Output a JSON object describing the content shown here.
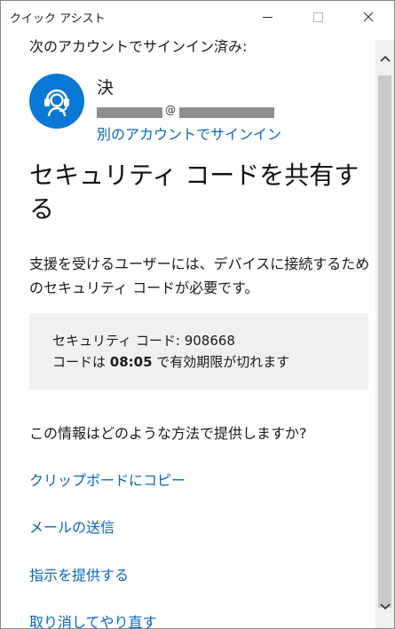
{
  "window": {
    "title": "クイック アシスト"
  },
  "account": {
    "signed_in_label": "次のアカウントでサインイン済み:",
    "name": "決",
    "email_at": "@",
    "switch_label": "別のアカウントでサインイン"
  },
  "heading": "セキュリティ コードを共有する",
  "description": "支援を受けるユーザーには、デバイスに接続するためのセキュリティ コードが必要です。",
  "code_box": {
    "code_prefix": "セキュリティ コード: ",
    "code": "908668",
    "expiry_prefix": "コードは ",
    "expiry_time": "08:05",
    "expiry_suffix": " で有効期限が切れます"
  },
  "share": {
    "question": "この情報はどのような方法で提供しますか?",
    "options": [
      "クリップボードにコピー",
      "メールの送信",
      "指示を提供する",
      "取り消してやり直す"
    ]
  },
  "colors": {
    "accent": "#0a78d6",
    "link": "#0a66c2",
    "code_box_bg": "#f0f0f0"
  },
  "icons": {
    "avatar": "headset-agent-icon",
    "minimize": "minimize-icon",
    "maximize": "maximize-icon",
    "close": "close-icon",
    "scroll_up": "chevron-up-icon",
    "scroll_down": "chevron-down-icon"
  }
}
